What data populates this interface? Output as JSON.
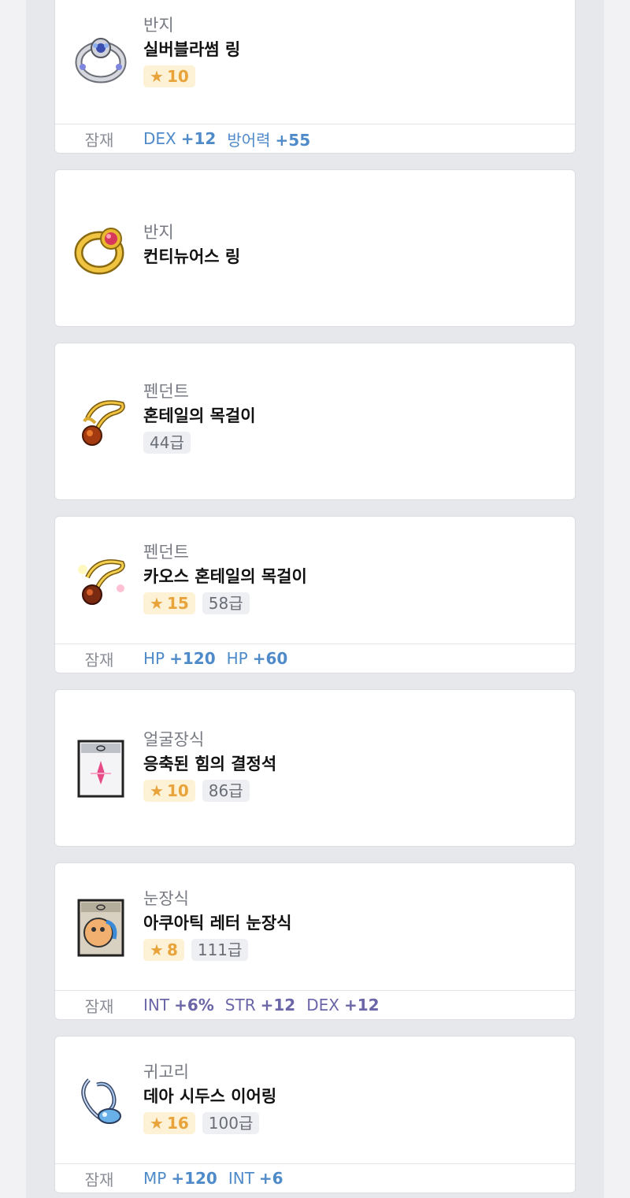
{
  "potential_label": "잠재",
  "colors": {
    "rare_potential": "#4f8ac9",
    "epic_potential": "#6b66a8",
    "star": "#e8a33a"
  },
  "items": [
    {
      "category": "반지",
      "name": "실버블라썸 링",
      "icon": "silver-blossom-ring-icon",
      "star_force": "10",
      "grade": null,
      "potentials": [
        {
          "stat": "DEX",
          "value": "+12"
        },
        {
          "stat": "방어력",
          "value": "+55"
        }
      ]
    },
    {
      "category": "반지",
      "name": "컨티뉴어스 링",
      "icon": "continuous-ring-icon",
      "star_force": null,
      "grade": null,
      "potentials": []
    },
    {
      "category": "펜던트",
      "name": "혼테일의 목걸이",
      "icon": "horntail-necklace-icon",
      "star_force": null,
      "grade": "44급",
      "potentials": []
    },
    {
      "category": "펜던트",
      "name": "카오스 혼테일의 목걸이",
      "icon": "chaos-horntail-necklace-icon",
      "star_force": "15",
      "grade": "58급",
      "potentials": [
        {
          "stat": "HP",
          "value": "+120"
        },
        {
          "stat": "HP",
          "value": "+60"
        }
      ]
    },
    {
      "category": "얼굴장식",
      "name": "응축된 힘의 결정석",
      "icon": "condensed-power-crystal-icon",
      "star_force": "10",
      "grade": "86급",
      "potentials": []
    },
    {
      "category": "눈장식",
      "name": "아쿠아틱 레터 눈장식",
      "icon": "aquatic-letter-eye-accessory-icon",
      "star_force": "8",
      "grade": "111급",
      "potentials": [
        {
          "stat": "INT",
          "value": "+6%"
        },
        {
          "stat": "STR",
          "value": "+12"
        },
        {
          "stat": "DEX",
          "value": "+12"
        }
      ]
    },
    {
      "category": "귀고리",
      "name": "데아 시두스 이어링",
      "icon": "dea-sidus-earring-icon",
      "star_force": "16",
      "grade": "100급",
      "potentials": [
        {
          "stat": "MP",
          "value": "+120"
        },
        {
          "stat": "INT",
          "value": "+6"
        }
      ]
    }
  ]
}
